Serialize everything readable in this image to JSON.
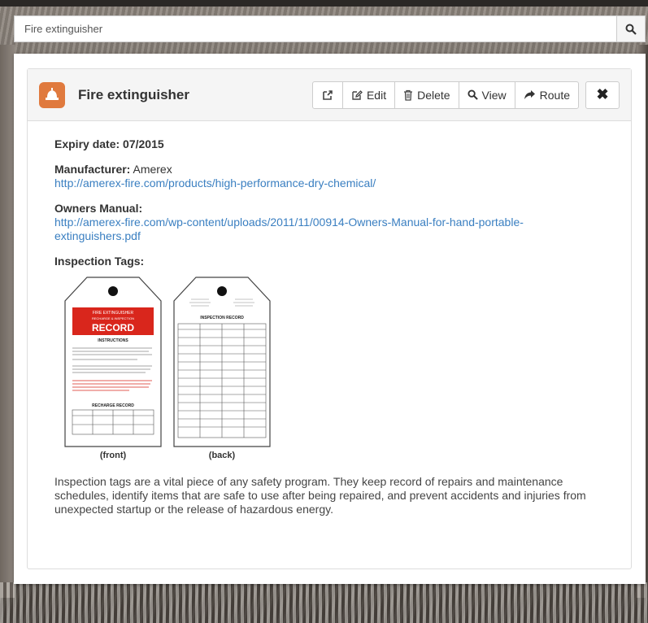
{
  "search": {
    "value": "Fire extinguisher",
    "button_icon": "search-icon"
  },
  "card": {
    "title": "Fire extinguisher",
    "marker_icon": "fire-extinguisher-marker-icon",
    "marker_color": "#e07a3e",
    "buttons": {
      "open_external_icon": "external-link-icon",
      "edit_label": "Edit",
      "delete_label": "Delete",
      "view_label": "View",
      "route_label": "Route",
      "close_icon": "close-icon"
    }
  },
  "details": {
    "expiry_label": "Expiry date:",
    "expiry_value": "07/2015",
    "manufacturer_label": "Manufacturer:",
    "manufacturer_value": "Amerex",
    "manufacturer_url": "http://amerex-fire.com/products/high-performance-dry-chemical/",
    "manual_label": "Owners Manual:",
    "manual_url_line1": "http://amerex-fire.com/wp-content/uploads/2011/11/00914-Owners-Manual-for-hand-portable-",
    "manual_url_line2": "extinguishers.pdf",
    "tags_label": "Inspection Tags:"
  },
  "tags_image": {
    "front": {
      "banner_small": "FIRE EXTINGUISHER",
      "banner_sub": "RECHARGE & INSPECTION",
      "banner_big": "RECORD",
      "instructions": "INSTRUCTIONS",
      "recharge": "RECHARGE RECORD",
      "caption": "(front)"
    },
    "back": {
      "heading": "INSPECTION RECORD",
      "caption": "(back)"
    },
    "link_color": "#3a7fc1",
    "red": "#d9261c"
  },
  "description": "Inspection tags are a vital piece of any safety program.  They keep record of repairs and maintenance schedules, identify items that are safe to use after being repaired, and prevent accidents and injuries from unexpected startup or the release of hazardous energy."
}
